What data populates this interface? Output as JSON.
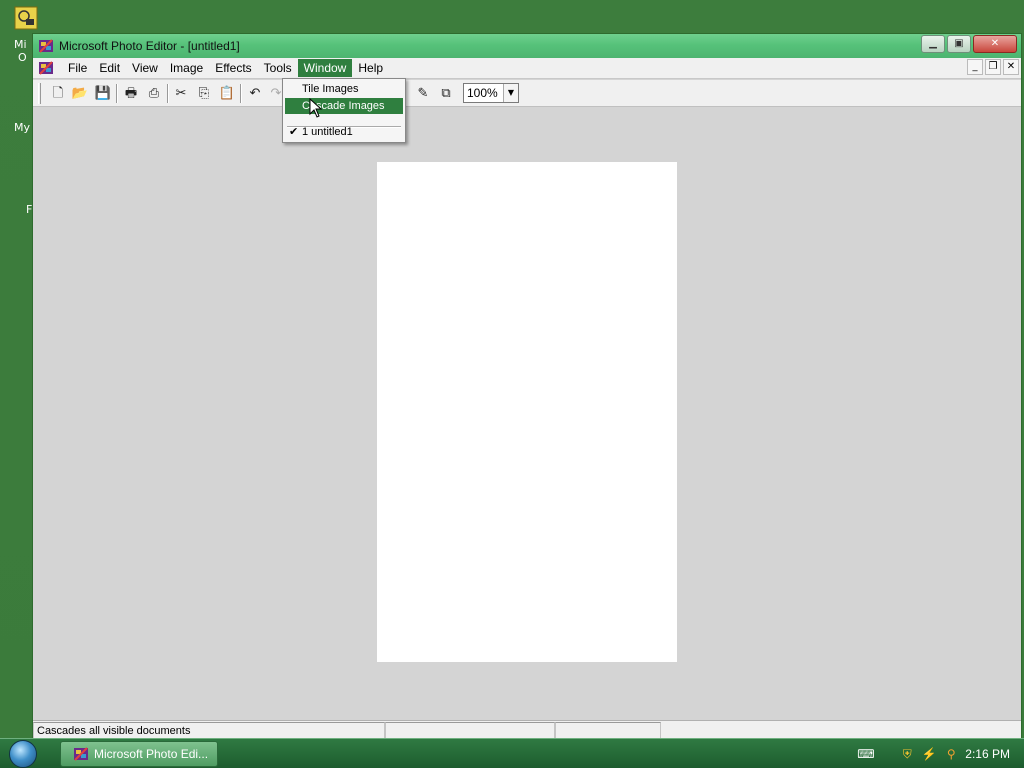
{
  "window": {
    "title": "Microsoft Photo Editor - [untitled1]"
  },
  "menubar": {
    "items": [
      {
        "label": "File"
      },
      {
        "label": "Edit"
      },
      {
        "label": "View"
      },
      {
        "label": "Image"
      },
      {
        "label": "Effects"
      },
      {
        "label": "Tools"
      },
      {
        "label": "Window",
        "active": true
      },
      {
        "label": "Help"
      }
    ]
  },
  "toolbar": {
    "zoom_value": "100%"
  },
  "window_menu": {
    "items": [
      {
        "label": "Tile Images",
        "highlighted": false,
        "checked": false
      },
      {
        "label": "Cascade Images",
        "highlighted": true,
        "checked": false
      },
      {
        "label": "1 untitled1",
        "highlighted": false,
        "checked": true
      }
    ]
  },
  "statusbar": {
    "message": "Cascades all visible documents"
  },
  "taskbar": {
    "task_label": "Microsoft Photo Edi...",
    "clock": "2:16 PM"
  },
  "desktop": {
    "labels": [
      "Mi",
      "O",
      "My",
      "F"
    ]
  },
  "colors": {
    "accent": "#2f7f3f",
    "titlebar": "#56c27a",
    "desktop": "#3d7d3d"
  }
}
